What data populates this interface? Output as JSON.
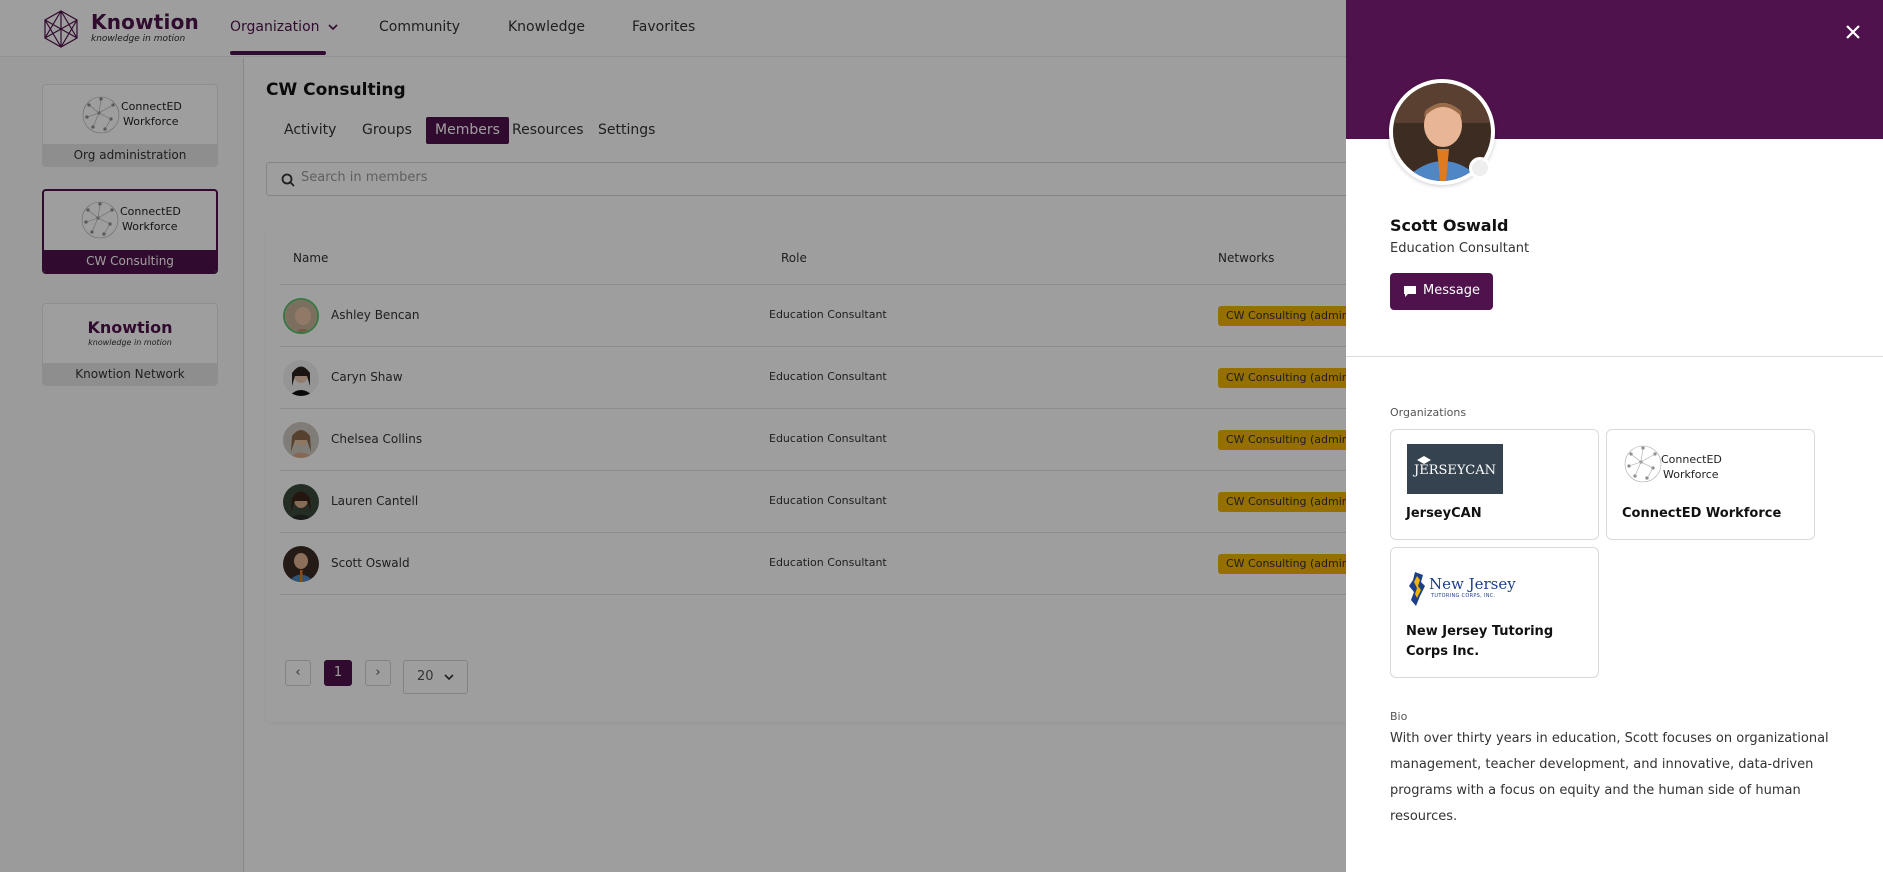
{
  "brand": {
    "name": "Knowtion",
    "tagline": "knowledge in motion",
    "accent": "#50124d",
    "badge_color": "#f1b400"
  },
  "nav": {
    "items": [
      {
        "label": "Organization",
        "active": true
      },
      {
        "label": "Community"
      },
      {
        "label": "Knowledge"
      },
      {
        "label": "Favorites"
      }
    ]
  },
  "sidebar": {
    "orgs": [
      {
        "logo_line1": "ConnectED",
        "logo_line2": "Workforce",
        "label": "Org administration"
      },
      {
        "logo_line1": "ConnectED",
        "logo_line2": "Workforce",
        "label": "CW Consulting",
        "active": true
      },
      {
        "logo_title": "Knowtion",
        "logo_tagline": "knowledge in motion",
        "label": "Knowtion Network"
      }
    ]
  },
  "main": {
    "title": "CW Consulting",
    "tabs": [
      "Activity",
      "Groups",
      "Members",
      "Resources",
      "Settings"
    ],
    "active_tab": "Members",
    "search": {
      "placeholder": "Search in members",
      "icon": "search-icon"
    },
    "table": {
      "columns": [
        "Name",
        "Role",
        "Networks"
      ],
      "rows": [
        {
          "name": "Ashley Bencan",
          "role": "Education Consultant",
          "network": "CW Consulting (admin)"
        },
        {
          "name": "Caryn Shaw",
          "role": "Education Consultant",
          "network": "CW Consulting (admin)"
        },
        {
          "name": "Chelsea Collins",
          "role": "Education Consultant",
          "network": "CW Consulting (admin)"
        },
        {
          "name": "Lauren Cantell",
          "role": "Education Consultant",
          "network": "CW Consulting (admin)"
        },
        {
          "name": "Scott Oswald",
          "role": "Education Consultant",
          "network": "CW Consulting (admin)"
        }
      ]
    },
    "pagination": {
      "prev": "‹",
      "page": "1",
      "next": "›",
      "page_size": "20"
    }
  },
  "panel": {
    "close": "×",
    "name": "Scott Oswald",
    "role": "Education Consultant",
    "message_label": "Message",
    "organizations_label": "Organizations",
    "organizations": [
      {
        "name": "JerseyCAN",
        "logo_text": "JERSEYCAN"
      },
      {
        "name": "ConnectED Workforce",
        "logo_line1": "ConnectED",
        "logo_line2": "Workforce"
      },
      {
        "name": "New Jersey Tutoring Corps Inc.",
        "logo_text": "New Jersey",
        "logo_sub": "TUTORING CORPS, INC."
      }
    ],
    "bio_label": "Bio",
    "bio": "With over thirty years in education, Scott focuses on organizational management, teacher development, and innovative, data-driven programs with a focus on equity and the human side of human resources."
  }
}
